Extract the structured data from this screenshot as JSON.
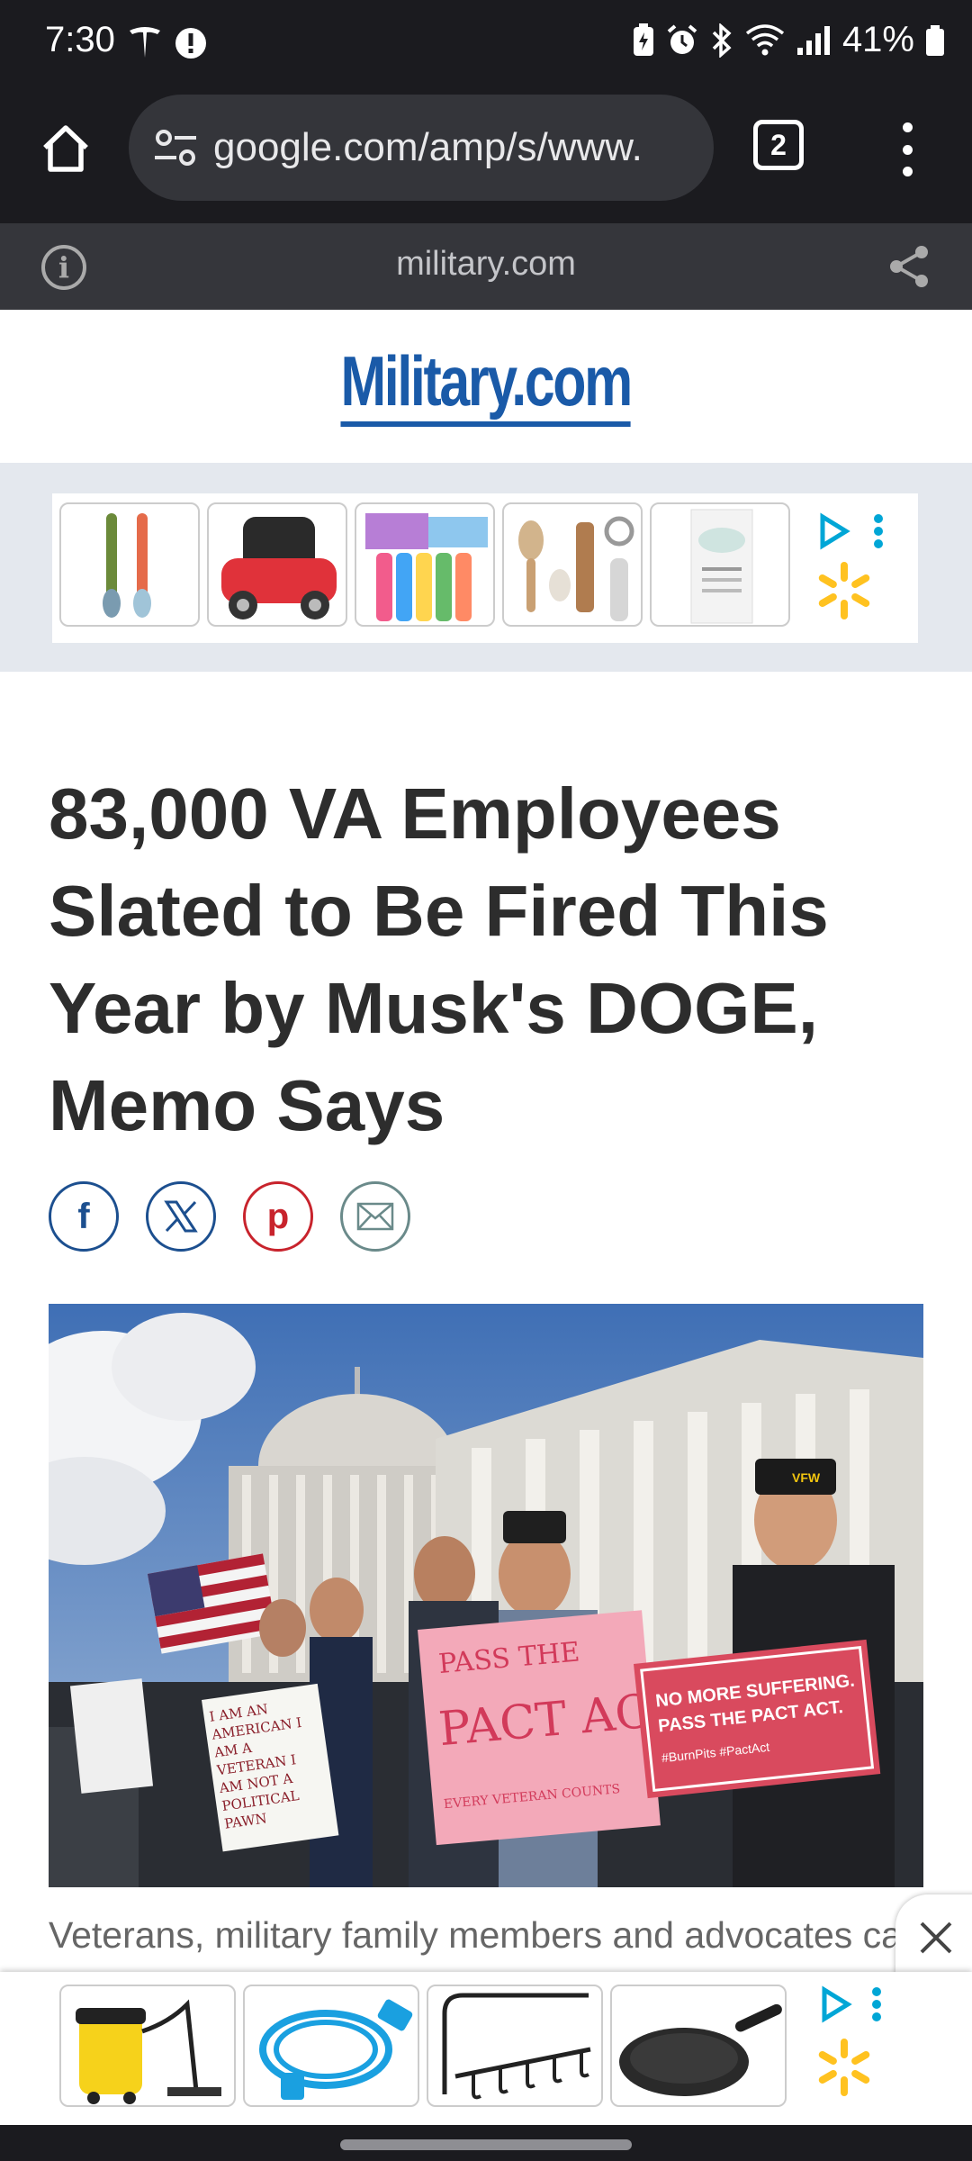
{
  "status_bar": {
    "time": "7:30",
    "battery": "41%"
  },
  "browser": {
    "url": "google.com/amp/s/www.",
    "tab_count": "2",
    "domain": "military.com"
  },
  "site": {
    "logo": "Military.com"
  },
  "article": {
    "headline": "83,000 VA Employees Slated to Be Fired This Year by Musk's DOGE, Memo Says",
    "caption": "Veterans, military family members and advocates call"
  },
  "photo_signs": {
    "sign1_line1": "PASS THE",
    "sign1_line2": "PACT ACT",
    "sign1_line3": "EVERY VETERAN COUNTS",
    "sign2_line1": "NO MORE SUFFERING.",
    "sign2_line2": "PASS THE PACT ACT.",
    "sign2_tags": "#BurnPits   #PactAct",
    "sign3": "I AM AN AMERICAN I AM A VETERAN I AM NOT A POLITICAL PAWN",
    "cap_text": "VFW"
  },
  "colors": {
    "brand": "#1a5aa8",
    "walmart_yellow": "#ffc220",
    "adchoices": "#00a6d6"
  }
}
